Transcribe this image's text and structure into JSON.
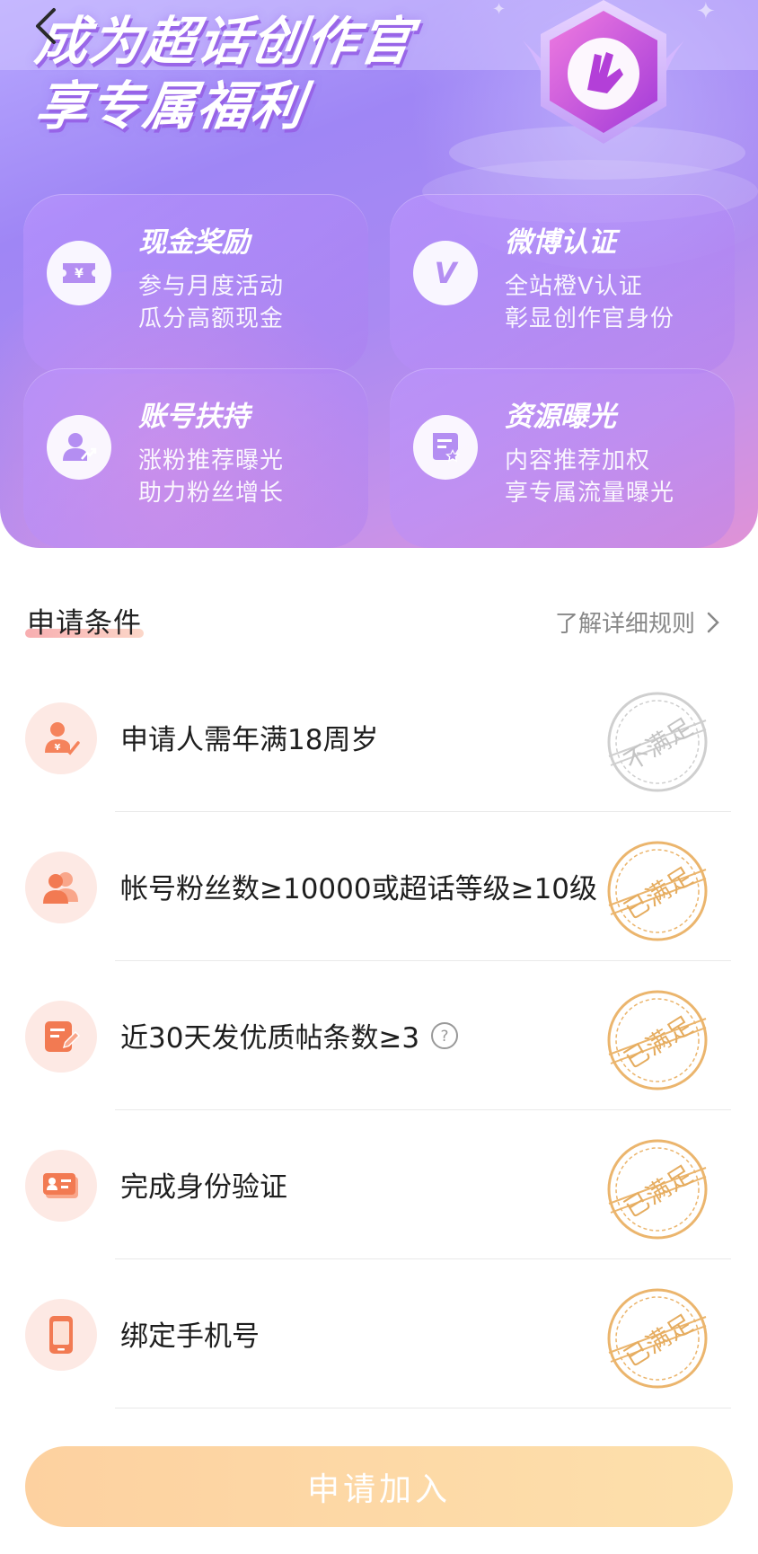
{
  "hero": {
    "title_line1": "成为超话创作官",
    "title_line2": "享专属福利"
  },
  "benefits": [
    {
      "title": "现金奖励",
      "line1": "参与月度活动",
      "line2": "瓜分高额现金",
      "icon": "cash-ticket-icon"
    },
    {
      "title": "微博认证",
      "line1": "全站橙V认证",
      "line2": "彰显创作官身份",
      "icon": "v-verified-icon"
    },
    {
      "title": "账号扶持",
      "line1": "涨粉推荐曝光",
      "line2": "助力粉丝增长",
      "icon": "user-growth-icon"
    },
    {
      "title": "资源曝光",
      "line1": "内容推荐加权",
      "line2": "享专属流量曝光",
      "icon": "content-star-icon"
    }
  ],
  "conditions_section": {
    "title": "申请条件",
    "rules_link": "了解详细规则"
  },
  "conditions": [
    {
      "text": "申请人需年满18周岁",
      "stamp": "不满足",
      "status": "unmet",
      "icon": "person-check-icon",
      "has_help": false
    },
    {
      "text": "帐号粉丝数≥10000或超话等级≥10级",
      "stamp": "已满足",
      "status": "met",
      "icon": "fans-icon",
      "has_help": false
    },
    {
      "text": "近30天发优质帖条数≥3",
      "stamp": "已满足",
      "status": "met",
      "icon": "edit-post-icon",
      "has_help": true
    },
    {
      "text": "完成身份验证",
      "stamp": "已满足",
      "status": "met",
      "icon": "id-card-icon",
      "has_help": false
    },
    {
      "text": "绑定手机号",
      "stamp": "已满足",
      "status": "met",
      "icon": "phone-icon",
      "has_help": false
    }
  ],
  "colors": {
    "met_stamp": "#e9b46c",
    "unmet_stamp": "#c9c9c9",
    "icon_orange": "#f27a52",
    "apply_button": "#fdd6a6"
  },
  "apply_button": {
    "label": "申请加入",
    "enabled": false
  }
}
